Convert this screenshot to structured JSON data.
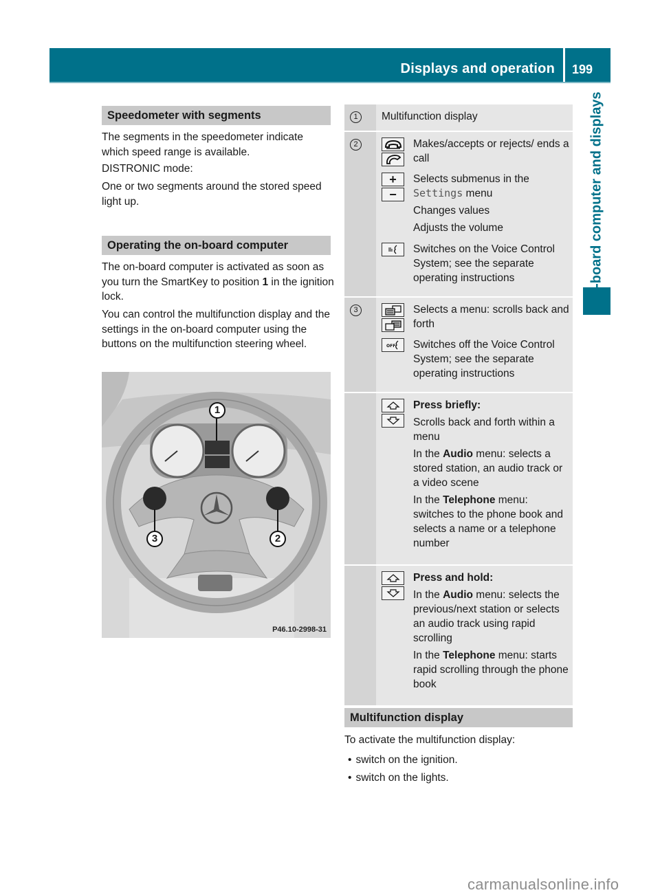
{
  "header": {
    "title": "Displays and operation",
    "page_number": "199",
    "side_tab": "On-board computer and displays"
  },
  "left": {
    "speedo_heading": "Speedometer with segments",
    "speedo_p1": "The segments in the speedometer indicate which speed range is available.",
    "speedo_p2": "DISTRONIC mode:",
    "speedo_p3": "One or two segments around the stored speed light up.",
    "operating_heading": "Operating the on-board computer",
    "operating_p1_pre": "The on-board computer is activated as soon as you turn the SmartKey to position ",
    "operating_p1_bold": "1",
    "operating_p1_post": " in the ignition lock.",
    "operating_p2": "You can control the multifunction display and the settings in the on-board computer using the buttons on the multifunction steering wheel.",
    "figure": {
      "code": "P46.10-2998-31",
      "callouts": [
        "1",
        "2",
        "3"
      ]
    }
  },
  "table": {
    "rows": [
      {
        "num": "1",
        "text": "Multifunction display"
      },
      {
        "num": "2",
        "items": [
          {
            "icon": "phone-accept-reject-icon",
            "text": "Makes/accepts or rejects/ ends a call"
          },
          {
            "icon": "plus-minus-icon",
            "text_pre": "Selects submenus in the ",
            "text_mono": "Settings",
            "text_post": " menu",
            "extra": [
              "Changes values",
              "Adjusts the volume"
            ]
          },
          {
            "icon": "voice-control-on-icon",
            "text": "Switches on the Voice Control System; see the separate operating instructions"
          }
        ]
      },
      {
        "num": "3",
        "items": [
          {
            "icon": "menu-back-forth-icon",
            "text": "Selects a menu: scrolls back and forth"
          },
          {
            "icon": "voice-control-off-icon",
            "text": "Switches off the Voice Control System; see the separate operating instructions"
          }
        ]
      },
      {
        "num": "",
        "items": [
          {
            "icon": "up-down-arrow-icon",
            "heading": "Press briefly:",
            "p1": "Scrolls back and forth within a menu",
            "p2_pre": "In the ",
            "p2_bold": "Audio",
            "p2_post": " menu: selects a stored station, an audio track or a video scene",
            "p3_pre": "In the ",
            "p3_bold": "Telephone",
            "p3_post": " menu: switches to the phone book and selects a name or a telephone number"
          }
        ]
      },
      {
        "num": "",
        "items": [
          {
            "icon": "up-down-arrow-icon",
            "heading": "Press and hold:",
            "p2_pre": "In the ",
            "p2_bold": "Audio",
            "p2_post": " menu: selects the previous/next station or selects an audio track using rapid scrolling",
            "p3_pre": "In the ",
            "p3_bold": "Telephone",
            "p3_post": " menu: starts rapid scrolling through the phone book"
          }
        ]
      }
    ]
  },
  "mfd": {
    "heading": "Multifunction display",
    "intro": "To activate the multifunction display:",
    "bullets": [
      "switch on the ignition.",
      "switch on the lights."
    ]
  },
  "watermark": "carmanualsonline.info",
  "colors": {
    "brand": "#00718a",
    "heading_bg": "#c8c8c8",
    "table_bg": "#e6e6e6",
    "table_num_bg": "#d4d4d4"
  }
}
